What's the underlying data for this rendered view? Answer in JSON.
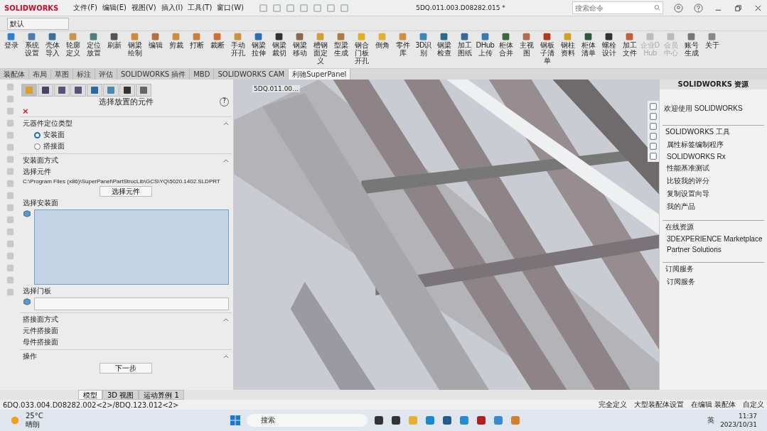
{
  "app": {
    "logo": "SOLIDWORKS",
    "menus": [
      "文件(F)",
      "编辑(E)",
      "视图(V)",
      "插入(I)",
      "工具(T)",
      "窗口(W)"
    ],
    "title": "5DQ.011.003.D08282.015 *",
    "search": {
      "placeholder": "搜索命令"
    }
  },
  "config": {
    "value": "默认"
  },
  "toolbar": [
    {
      "label": "登录",
      "color": "#2f7fd0",
      "disabled": false
    },
    {
      "label": "系统设置",
      "color": "#4a7da8",
      "disabled": false
    },
    {
      "label": "壳体导入",
      "color": "#3c6f9a",
      "disabled": false
    },
    {
      "label": "轮廓定义",
      "color": "#c8954a",
      "disabled": false
    },
    {
      "label": "定位放置",
      "color": "#4f7f7a",
      "disabled": false
    },
    {
      "label": "刷新",
      "color": "#555555",
      "disabled": false
    },
    {
      "label": "钢梁绘制",
      "color": "#d08a3a",
      "disabled": false
    },
    {
      "label": "编辑",
      "color": "#b07040",
      "disabled": false
    },
    {
      "label": "剪裁",
      "color": "#c89040",
      "disabled": false
    },
    {
      "label": "打断",
      "color": "#c8803a",
      "disabled": false
    },
    {
      "label": "裁断",
      "color": "#d07030",
      "disabled": false
    },
    {
      "label": "手动开孔",
      "color": "#d09040",
      "disabled": false
    },
    {
      "label": "钢梁拉伸",
      "color": "#2f6fb0",
      "disabled": false
    },
    {
      "label": "钢梁裁切",
      "color": "#333333",
      "disabled": false
    },
    {
      "label": "钢梁移动",
      "color": "#8a6a4a",
      "disabled": false
    },
    {
      "label": "槽钢面定义",
      "color": "#d0a030",
      "disabled": false
    },
    {
      "label": "型梁生成",
      "color": "#b07a40",
      "disabled": false
    },
    {
      "label": "钢合门板开孔",
      "color": "#e0b020",
      "disabled": false
    },
    {
      "label": "倒角",
      "color": "#e0b030",
      "disabled": false
    },
    {
      "label": "零件库",
      "color": "#d09040",
      "disabled": false
    },
    {
      "label": "3D识别",
      "color": "#3a8ab0",
      "disabled": false
    },
    {
      "label": "钢梁检查",
      "color": "#2a6a8a",
      "disabled": false
    },
    {
      "label": "加工图纸",
      "color": "#3a6a9a",
      "disabled": false
    },
    {
      "label": "DHub上传",
      "color": "#3a7ab0",
      "disabled": false
    },
    {
      "label": "柜体合并",
      "color": "#3a6a3a",
      "disabled": false
    },
    {
      "label": "主视图",
      "color": "#b07050",
      "disabled": false
    },
    {
      "label": "钢板子清单",
      "color": "#b03a20",
      "disabled": false
    },
    {
      "label": "钢柱资料",
      "color": "#d0a020",
      "disabled": false
    },
    {
      "label": "柜体清单",
      "color": "#2a5a3a",
      "disabled": false
    },
    {
      "label": "螺栓设计",
      "color": "#333333",
      "disabled": false
    },
    {
      "label": "加工文件",
      "color": "#c0603a",
      "disabled": false
    },
    {
      "label": "企业DHub",
      "color": "#bbbbbb",
      "disabled": true
    },
    {
      "label": "会员中心",
      "color": "#bbbbbb",
      "disabled": true
    },
    {
      "label": "账号生成",
      "color": "#777777",
      "disabled": false
    },
    {
      "label": "关于",
      "color": "#888888",
      "disabled": false
    }
  ],
  "tabs": [
    {
      "label": "装配体",
      "selected": false
    },
    {
      "label": "布局",
      "selected": false
    },
    {
      "label": "草图",
      "selected": false
    },
    {
      "label": "标注",
      "selected": false
    },
    {
      "label": "评估",
      "selected": false
    },
    {
      "label": "SOLIDWORKS 插件",
      "selected": false
    },
    {
      "label": "MBD",
      "selected": false
    },
    {
      "label": "SOLIDWORKS CAM",
      "selected": false
    },
    {
      "label": "利驰SuperPanel",
      "selected": true
    }
  ],
  "property_manager": {
    "title": "选择放置的元件",
    "help": "?",
    "close": "×",
    "positioning": {
      "heading": "元器件定位类型",
      "options": [
        {
          "label": "安装面",
          "selected": true
        },
        {
          "label": "搭接面",
          "selected": false
        }
      ]
    },
    "mounting": {
      "heading": "安装面方式",
      "component_label": "选择元件",
      "path": "C:\\Program Files (x86)\\SuperPanel\\PartStrucLib\\GCS\\YQ\\5020.1402.SLDPRT",
      "button": "选择元件",
      "face_label": "选择安装面",
      "door_label": "选择门板"
    },
    "overlap": {
      "heading": "搭接面方式",
      "items": [
        "元件搭接面",
        "母件搭接面"
      ]
    },
    "operation": {
      "heading": "操作",
      "button": "下一步"
    }
  },
  "viewport": {
    "tree_item": "5DQ.011.00..."
  },
  "task_pane": {
    "title": "SOLIDWORKS 资源",
    "welcome": "欢迎使用 SOLIDWORKS",
    "sections": [
      {
        "heading": "SOLIDWORKS 工具",
        "items": [
          "属性标签编制程序",
          "SOLIDWORKS Rx",
          "性能基准测试",
          "比较我的评分",
          "复制设置向导",
          "我的产品"
        ]
      },
      {
        "heading": "在线资源",
        "items": [
          "3DEXPERIENCE Marketplace",
          "Partner Solutions"
        ]
      },
      {
        "heading": "订阅服务",
        "items": [
          "订阅服务"
        ]
      }
    ]
  },
  "bottom_tabs": [
    {
      "label": "模型",
      "selected": true
    },
    {
      "label": "3D 视图",
      "selected": false
    },
    {
      "label": "运动算例 1",
      "selected": false
    }
  ],
  "status_bar": {
    "path": "6DQ.033.004.D08282.002<2>/8DQ.123.012<2>",
    "items": [
      "完全定义",
      "大型装配体设置",
      "在编辑 装配体"
    ],
    "units": "自定义"
  },
  "taskbar": {
    "temperature": "25°C",
    "weather": "晴朗",
    "search": "搜索",
    "language": "英",
    "time": "11:37",
    "date": "2023/10/31"
  }
}
